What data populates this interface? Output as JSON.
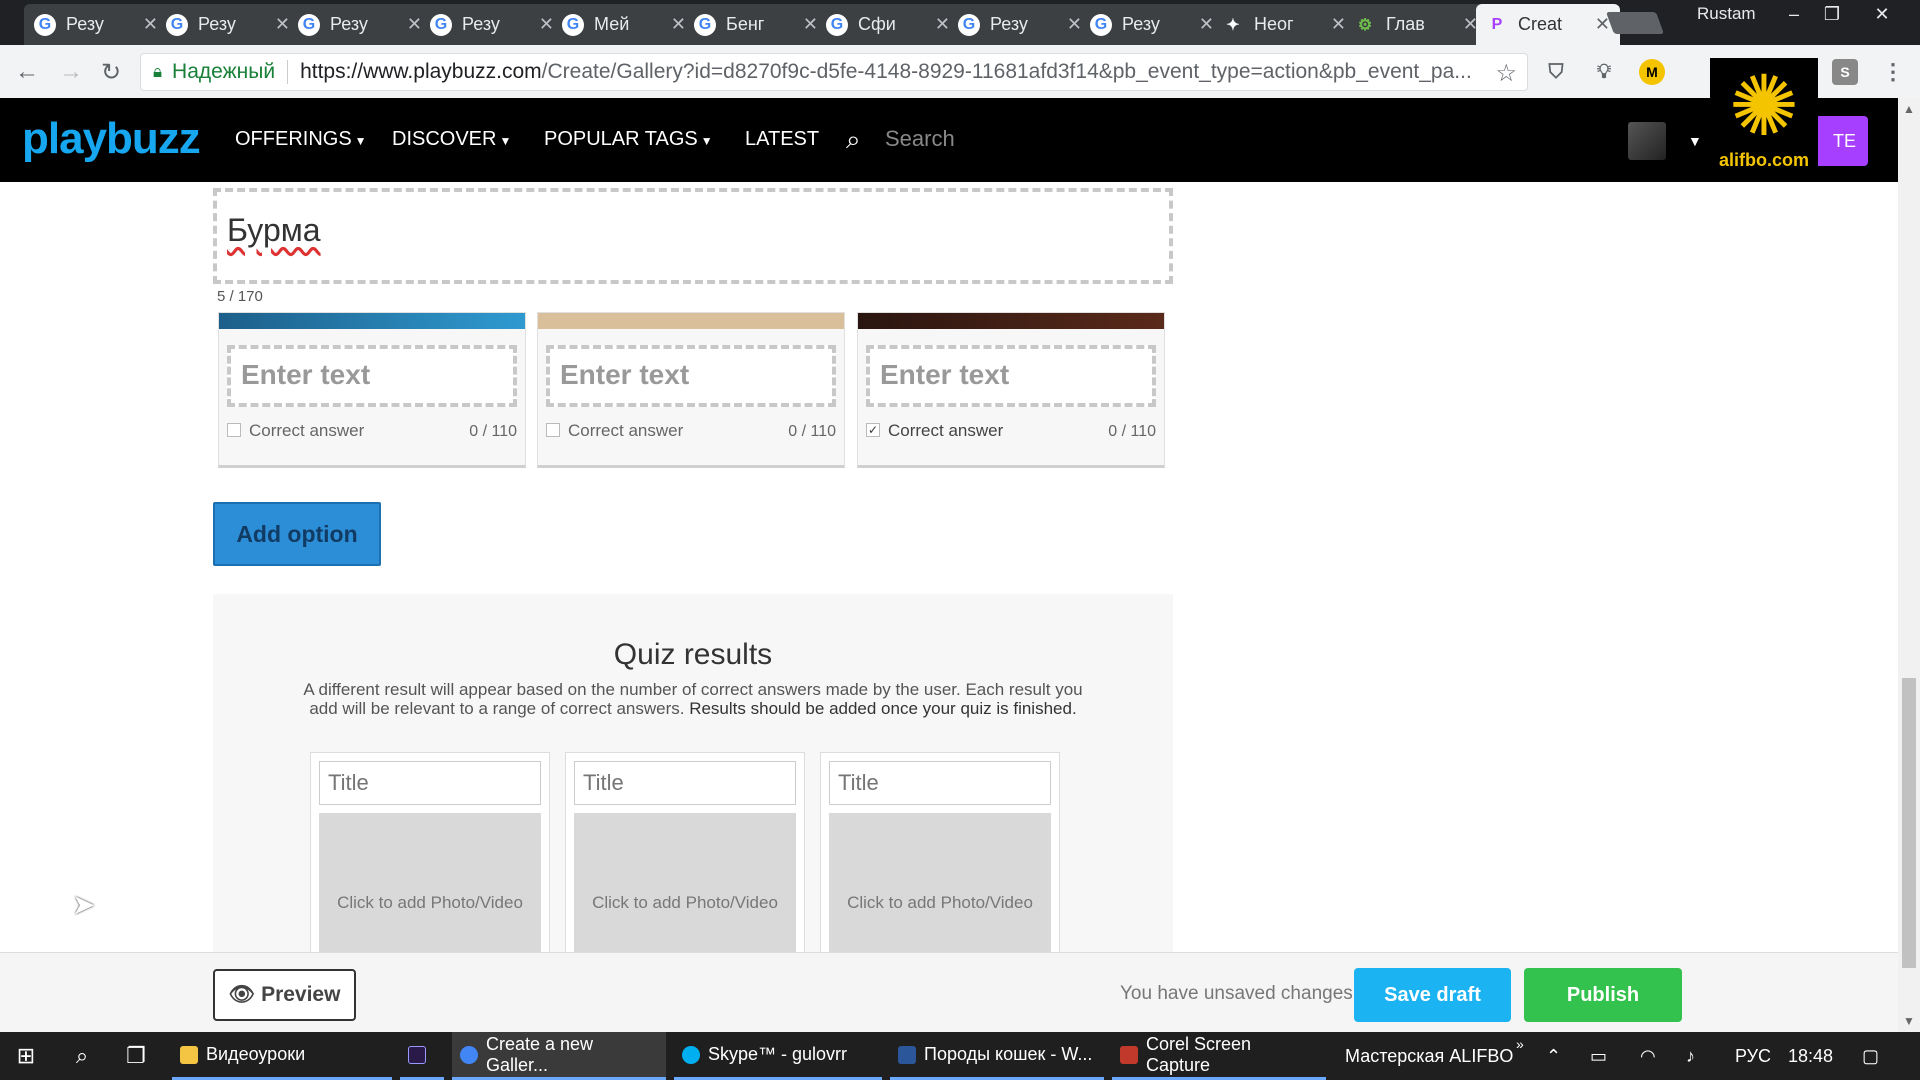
{
  "browser": {
    "tabs": [
      {
        "label": "Резу",
        "icon": "google-icon",
        "active": false
      },
      {
        "label": "Резу",
        "icon": "google-icon",
        "active": false
      },
      {
        "label": "Резу",
        "icon": "google-icon",
        "active": false
      },
      {
        "label": "Резу",
        "icon": "google-icon",
        "active": false
      },
      {
        "label": "Мей",
        "icon": "google-icon",
        "active": false
      },
      {
        "label": "Бенг",
        "icon": "google-icon",
        "active": false
      },
      {
        "label": "Сфи",
        "icon": "google-icon",
        "active": false
      },
      {
        "label": "Резу",
        "icon": "google-icon",
        "active": false
      },
      {
        "label": "Резу",
        "icon": "google-icon",
        "active": false
      },
      {
        "label": "Неог",
        "icon": "bird-icon",
        "active": false
      },
      {
        "label": "Глав",
        "icon": "gear-icon",
        "active": false
      },
      {
        "label": "Creat",
        "icon": "playbuzz-icon",
        "active": true
      }
    ],
    "user": "Rustam",
    "secure_label": "Надежный",
    "url_host": "https://www.playbuzz.com",
    "url_rest": "/Create/Gallery?id=d8270f9c-d5fe-4148-8929-11681afd3f14&pb_event_type=action&pb_event_pa..."
  },
  "site_nav": {
    "logo": "playbuzz",
    "offerings": "OFFERINGS",
    "discover": "DISCOVER",
    "popular_tags": "POPULAR TAGS",
    "latest": "LATEST",
    "search_placeholder": "Search",
    "create_label": "TE"
  },
  "watermark": {
    "text": "alifbo.com"
  },
  "question": {
    "title": "Бурма",
    "counter": "5 / 170"
  },
  "options": [
    {
      "placeholder": "Enter text",
      "correct_label": "Correct answer",
      "count": "0 / 110",
      "checked": false
    },
    {
      "placeholder": "Enter text",
      "correct_label": "Correct answer",
      "count": "0 / 110",
      "checked": false
    },
    {
      "placeholder": "Enter text",
      "correct_label": "Correct answer",
      "count": "0 / 110",
      "checked": true
    }
  ],
  "add_option_label": "Add option",
  "results": {
    "title": "Quiz results",
    "desc_plain": "A different result will appear based on the number of correct answers made by the user. Each result you add will be relevant to a range of correct answers.",
    "desc_bold": "Results should be added once your quiz is finished.",
    "cards": [
      {
        "title_placeholder": "Title",
        "photo_label": "Click to add Photo/Video"
      },
      {
        "title_placeholder": "Title",
        "photo_label": "Click to add Photo/Video"
      },
      {
        "title_placeholder": "Title",
        "photo_label": "Click to add Photo/Video"
      }
    ]
  },
  "footer": {
    "preview_label": "Preview",
    "unsaved_text": "You have unsaved changes!",
    "save_label": "Save draft",
    "publish_label": "Publish"
  },
  "taskbar": {
    "items": [
      {
        "label": "Видеоуроки",
        "color": "#f4c542"
      },
      {
        "label": "",
        "color": "#2a1a4a"
      },
      {
        "label": "Create a new Galler...",
        "color": "#4285f4"
      },
      {
        "label": "Skype™ - gulovrr",
        "color": "#00aff0"
      },
      {
        "label": "Породы кошек - W...",
        "color": "#2b579a"
      },
      {
        "label": "Corel Screen Capture",
        "color": "#c0392b"
      }
    ],
    "toolbar_label": "Мастерская ALIFBO",
    "language": "РУС",
    "time": "18:48"
  }
}
